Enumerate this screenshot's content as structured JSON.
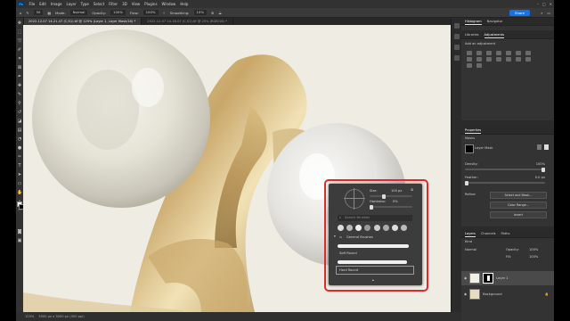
{
  "menu": {
    "logo": "Ps",
    "items": [
      "File",
      "Edit",
      "Image",
      "Layer",
      "Type",
      "Select",
      "Filter",
      "3D",
      "View",
      "Plugins",
      "Window",
      "Help"
    ],
    "window_controls": [
      "–",
      "□",
      "✕"
    ]
  },
  "options": {
    "size": "50",
    "mode_label": "Mode:",
    "mode_value": "Normal",
    "opacity_label": "Opacity:",
    "opacity_value": "100%",
    "flow_label": "Flow:",
    "flow_value": "100%",
    "smoothing_label": "Smoothing:",
    "smoothing_value": "10%",
    "share_label": "Share"
  },
  "tabs": [
    {
      "label": "2022-12-07 14-21-47 (C,S1).tif @ 125% (Layer 1, Layer Mask/16) *",
      "active": true
    },
    {
      "label": "2022-12-07 14-18-07 (C,S1).tif @ 25% (RGB/16) *",
      "active": false
    }
  ],
  "status": {
    "zoom": "125%",
    "doc": "3000 px x 3000 px (300 ppi)"
  },
  "panels": {
    "histogram": {
      "tabs": [
        "Histogram",
        "Navigator"
      ]
    },
    "adjustments": {
      "tabs": [
        "Libraries",
        "Adjustments"
      ],
      "hint": "Add an adjustment"
    },
    "properties": {
      "tab": "Properties",
      "type": "Masks",
      "layer_name": "Layer Mask",
      "density_label": "Density:",
      "density_value": "100%",
      "feather_label": "Feather:",
      "feather_value": "0.0 px",
      "refine_label": "Refine:",
      "select_mask_label": "Select and Mask...",
      "color_range_label": "Color Range...",
      "invert_label": "Invert"
    },
    "layers": {
      "tabs": [
        "Layers",
        "Channels",
        "Paths"
      ],
      "kind": "Kind",
      "blend": "Normal",
      "opacity_label": "Opacity:",
      "opacity_value": "100%",
      "fill_label": "Fill:",
      "fill_value": "100%",
      "layer1": "Layer 1",
      "background": "Background"
    }
  },
  "brush_popup": {
    "size_label": "Size:",
    "size_value": "100 px",
    "hardness_label": "Hardness:",
    "hardness_value": "0%",
    "search_placeholder": "Search Brushes",
    "group_label": "General Brushes",
    "brush1": "Soft Round",
    "brush2": "Hard Round"
  },
  "colors": {
    "highlight": "#e02a2a",
    "accent": "#1473e6"
  }
}
